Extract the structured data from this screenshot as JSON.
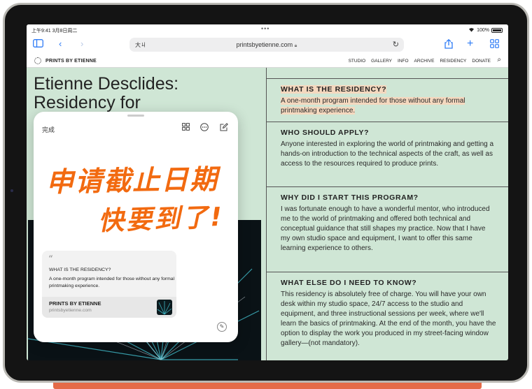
{
  "status_bar": {
    "time": "上午9:41",
    "date": "3月8日周二",
    "battery": "100%"
  },
  "toolbar": {
    "text_size": "大ㄐ",
    "domain": "printsbyetienne.com"
  },
  "site": {
    "brand": "PRINTS BY ETIENNE",
    "nav": [
      "STUDIO",
      "GALLERY",
      "INFO",
      "ARCHIVE",
      "RESIDENCY",
      "DONATE"
    ],
    "hero_title": "Etienne Desclides: Residency for"
  },
  "faq": [
    {
      "q": "WHAT IS THE RESIDENCY?",
      "a": "A one-month program intended for those without any formal printmaking experience."
    },
    {
      "q": "WHO SHOULD APPLY?",
      "a": "Anyone interested in exploring the world of printmaking and getting a hands-on introduction to the technical aspects of the craft, as well as access to the resources required to produce prints."
    },
    {
      "q": "WHY DID I START THIS PROGRAM?",
      "a": "I was fortunate enough to have a wonderful mentor, who introduced me to the world of printmaking and offered both technical and conceptual guidance that still shapes my practice. Now that I have my own studio space and equipment, I want to offer this same learning experience to others."
    },
    {
      "q": "WHAT ELSE DO I NEED TO KNOW?",
      "a": "This residency is absolutely free of charge. You will have your own desk within my studio space, 24/7 access to the studio and equipment, and three instructional sessions per week, where we'll learn the basics of printmaking. At the end of the month, you have the option to display the work you produced in my street-facing window gallery—(not mandatory)."
    }
  ],
  "quick_note": {
    "done_label": "完成",
    "handwriting_line1": "申请截止日期",
    "handwriting_line2": "快要到了!",
    "link_card": {
      "quote_title": "WHAT IS THE RESIDENCY?",
      "quote_body": "A one-month program intended for those without any formal printmaking experience.",
      "site_title": "PRINTS BY ETIENNE",
      "site_url": "printsbyetienne.com"
    }
  },
  "colors": {
    "page_bg": "#cfe6d5",
    "accent": "#2f7cf6",
    "handwriting": "#f26a10",
    "highlight": "#f4d8bf"
  }
}
